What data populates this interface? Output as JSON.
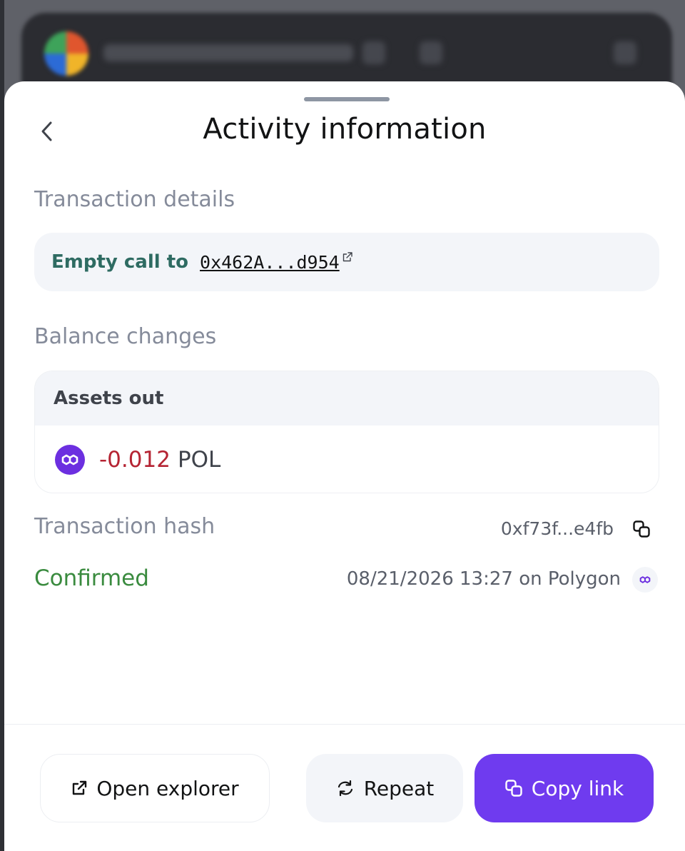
{
  "header": {
    "title": "Activity information"
  },
  "transaction_details": {
    "label": "Transaction details",
    "call_label": "Empty call to",
    "address": "0x462A...d954"
  },
  "balance_changes": {
    "label": "Balance changes",
    "assets_out_label": "Assets out",
    "amount": "-0.012",
    "symbol": "POL"
  },
  "transaction_hash": {
    "label": "Transaction hash",
    "value": "0xf73f...e4fb"
  },
  "status": {
    "label": "Confirmed",
    "date_network": "08/21/2026 13:27 on Polygon"
  },
  "actions": {
    "open_explorer": "Open explorer",
    "repeat": "Repeat",
    "copy_link": "Copy link"
  },
  "colors": {
    "accent": "#6f3bef",
    "negative_amount": "#b52433",
    "confirmed": "#3a8b3f",
    "call_label": "#2e6b62",
    "polygon": "#6c2fe0"
  },
  "icons": {
    "back": "chevron-left-icon",
    "external": "external-link-icon",
    "copy": "copy-icon",
    "repeat": "repeat-icon",
    "token": "polygon-icon"
  }
}
